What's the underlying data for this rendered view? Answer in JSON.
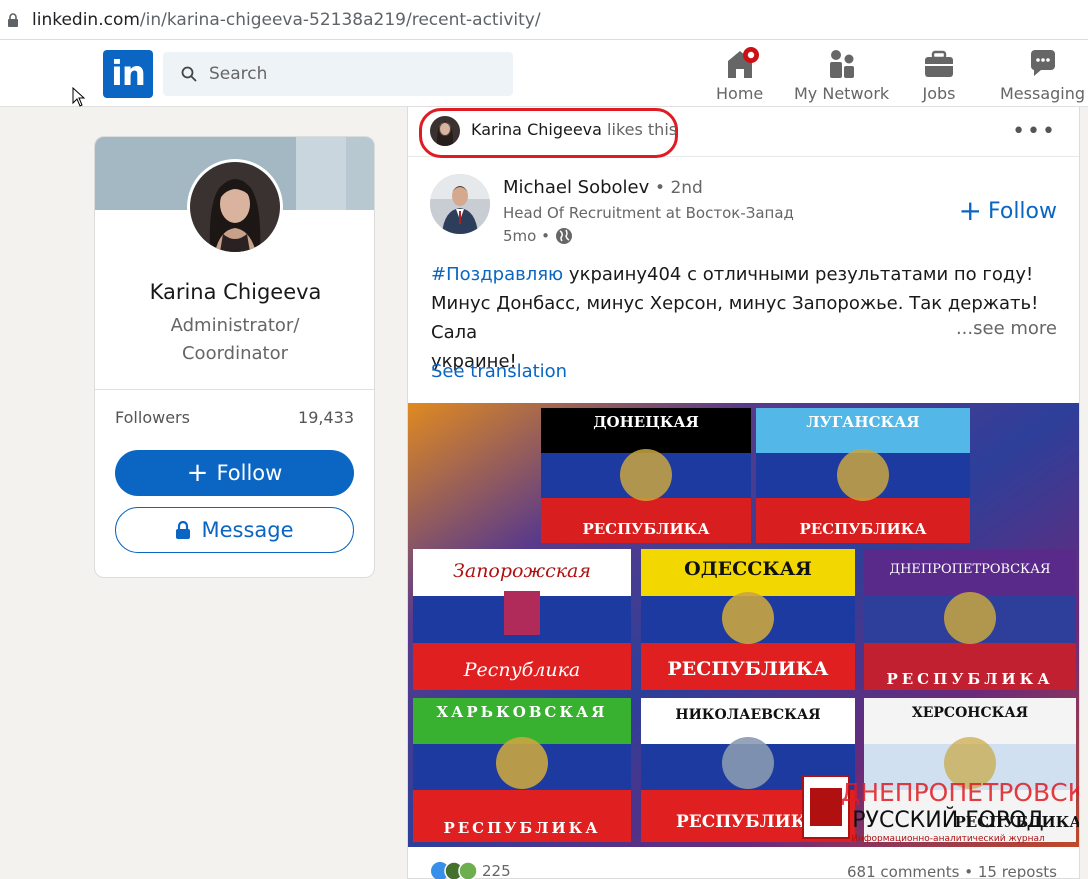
{
  "browser": {
    "url_domain": "linkedin.com",
    "url_path": "/in/karina-chigeeva-52138a219/recent-activity/"
  },
  "header": {
    "logo_text": "in",
    "search_placeholder": "Search",
    "nav": [
      {
        "label": "Home",
        "icon": "home-icon"
      },
      {
        "label": "My Network",
        "icon": "network-icon"
      },
      {
        "label": "Jobs",
        "icon": "briefcase-icon"
      },
      {
        "label": "Messaging",
        "icon": "messaging-icon"
      }
    ]
  },
  "profile": {
    "name": "Karina Chigeeva",
    "title": "Administrator/ Coordinator",
    "followers_label": "Followers",
    "followers_count": "19,433",
    "follow_label": "Follow",
    "message_label": "Message"
  },
  "post": {
    "liker_name": "Karina Chigeeva",
    "liker_action": "likes this",
    "author_name": "Michael Sobolev",
    "author_degree": "• 2nd",
    "author_headline": "Head Of Recruitment at Восток-Запад",
    "time": "5mo •",
    "follow_label": "Follow",
    "hashtag": "#Поздравляю",
    "text_line1_rest": " украину404 с отличными результатами по году!",
    "text_line2": "Минус Донбасс, минус Херсон, минус Запорожье. Так держать! Сала",
    "text_line3": "украине!",
    "see_more": "...see more",
    "see_translation": "See translation",
    "reaction_count": "225",
    "comments_reposts": "681 comments • 15 reposts",
    "image_flags": [
      {
        "top": "ДОНЕЦКАЯ",
        "bottom": "РЕСПУБЛИКА"
      },
      {
        "top": "ЛУГАНСКАЯ",
        "bottom": "РЕСПУБЛИКА"
      },
      {
        "top": "Запорожская",
        "bottom": "Республика"
      },
      {
        "top": "ОДЕССКАЯ",
        "bottom": "РЕСПУБЛИКА"
      },
      {
        "top": "ДНЕПРОПЕТРОВСКАЯ",
        "bottom": "РЕСПУБЛИКА"
      },
      {
        "top": "ХАРЬКОВСКАЯ",
        "bottom": "РЕСПУБЛИКА"
      },
      {
        "top": "НИКОЛАЕВСКАЯ",
        "bottom": "РЕСПУБЛИКА"
      },
      {
        "top": "ХЕРСОНСКАЯ",
        "bottom": "РЕСПУБЛИКА"
      }
    ],
    "image_watermark_top": "ДНЕПРОПЕТРОВСК",
    "image_watermark_main": "РУССКИЙ ГОРОД",
    "image_watermark_sub": "Информационно-аналитический журнал"
  },
  "colors": {
    "brand_blue": "#0a66c2",
    "highlight_red": "#e01b24"
  }
}
